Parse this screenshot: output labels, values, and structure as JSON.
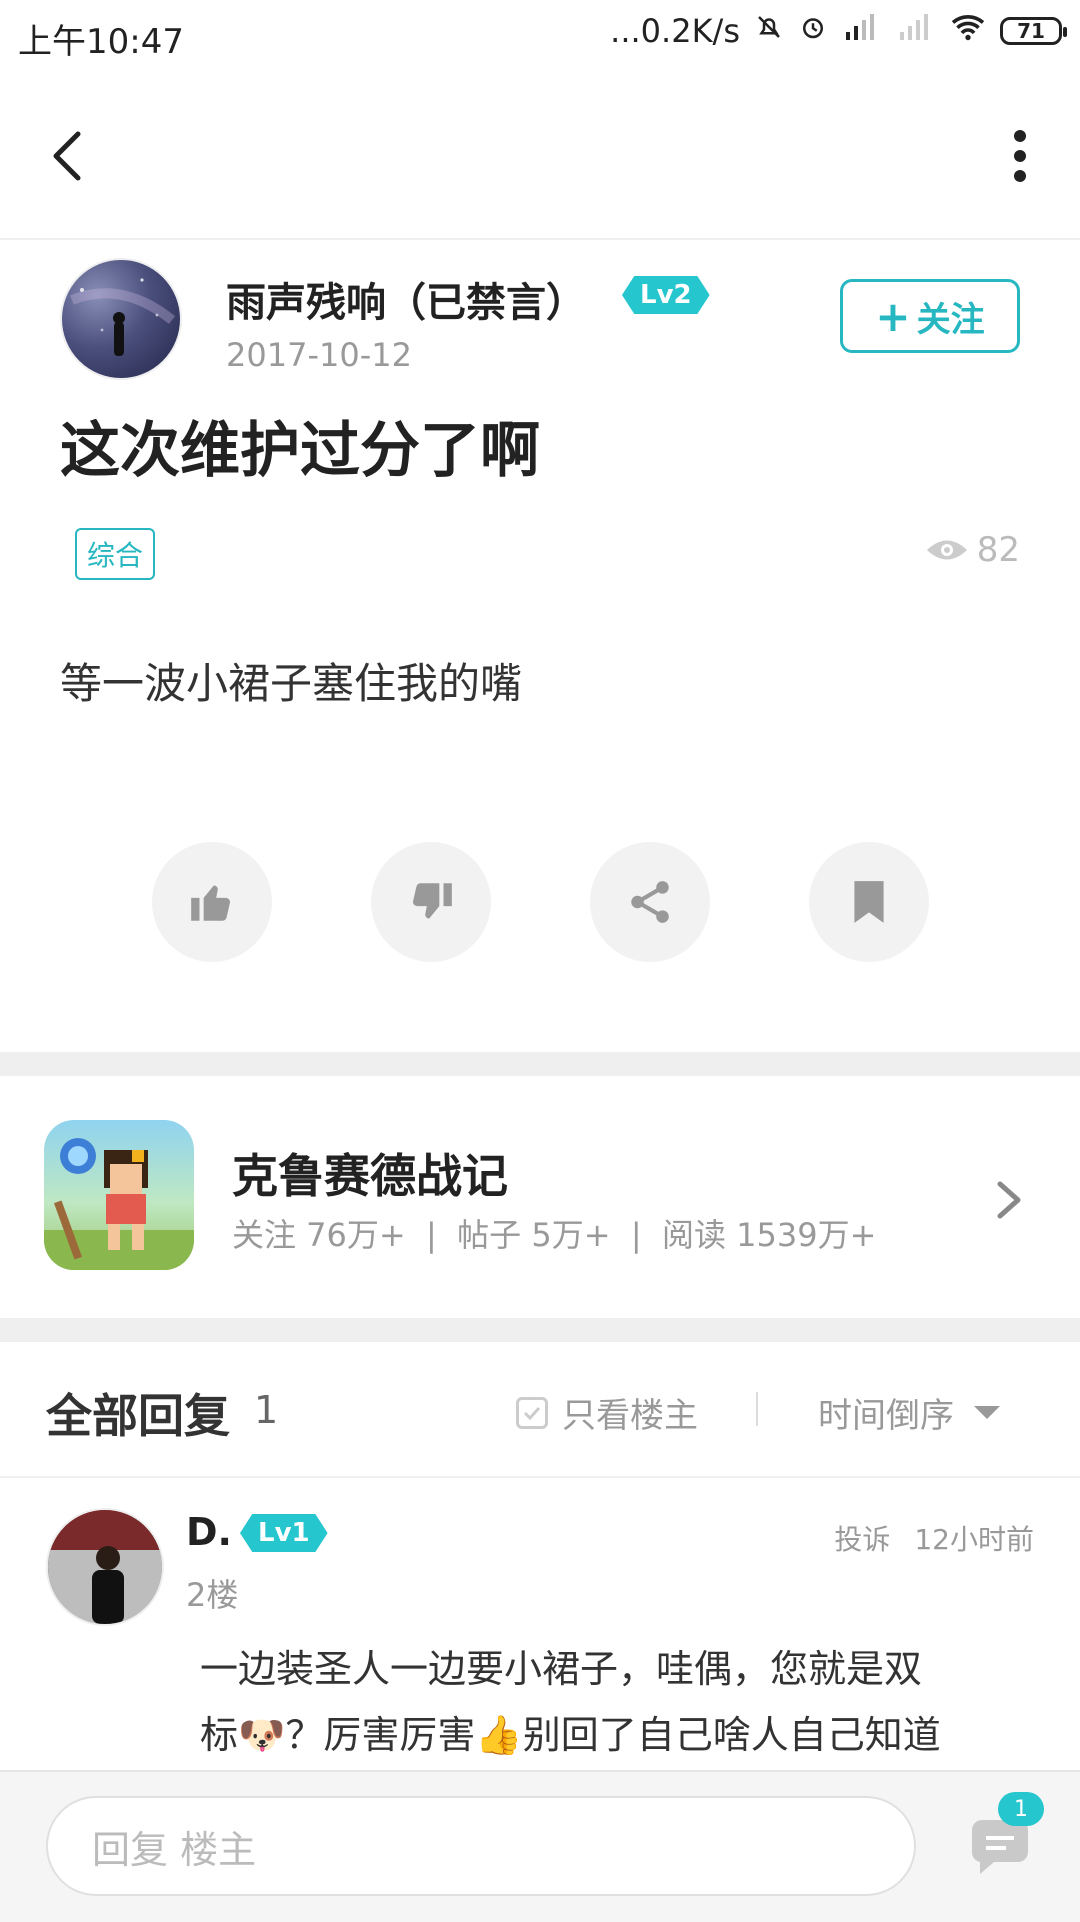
{
  "status_bar": {
    "time": "上午10:47",
    "network_speed": "...0.2K/s",
    "battery": "71"
  },
  "nav": {
    "back_icon": "chevron-left-icon",
    "more_icon": "more-vertical-icon"
  },
  "post": {
    "author": {
      "name": "雨声残响（已禁言）",
      "level": "Lv2",
      "date": "2017-10-12"
    },
    "follow_label": "关注",
    "follow_plus": "+",
    "title": "这次维护过分了啊",
    "category": "综合",
    "views": "82",
    "body": "等一波小裙子塞住我的嘴",
    "actions": [
      {
        "name": "like-button",
        "icon": "thumbs-up-icon"
      },
      {
        "name": "dislike-button",
        "icon": "thumbs-down-icon"
      },
      {
        "name": "share-button",
        "icon": "share-icon"
      },
      {
        "name": "bookmark-button",
        "icon": "bookmark-icon"
      }
    ]
  },
  "game": {
    "name": "克鲁赛德战记",
    "stats": "关注 76万+  |  帖子 5万+  |  阅读 1539万+"
  },
  "replies": {
    "title": "全部回复",
    "count": "1",
    "only_op_label": "只看楼主",
    "sort_label": "时间倒序",
    "items": [
      {
        "user": "D.",
        "level": "Lv1",
        "floor": "2楼",
        "report": "投诉",
        "time": "12小时前",
        "line1": "一边装圣人一边要小裙子，哇偶，您就是双",
        "line2_a": "标",
        "emoji1": "🐶",
        "line2_b": "？厉害厉害",
        "emoji2": "👍",
        "line2_c": "别回了自己啥人自己知道"
      }
    ]
  },
  "bottom": {
    "reply_placeholder": "回复  楼主",
    "comment_badge": "1"
  },
  "colors": {
    "accent": "#26c6ce",
    "muted_text": "#999999",
    "separator": "#efefef"
  }
}
